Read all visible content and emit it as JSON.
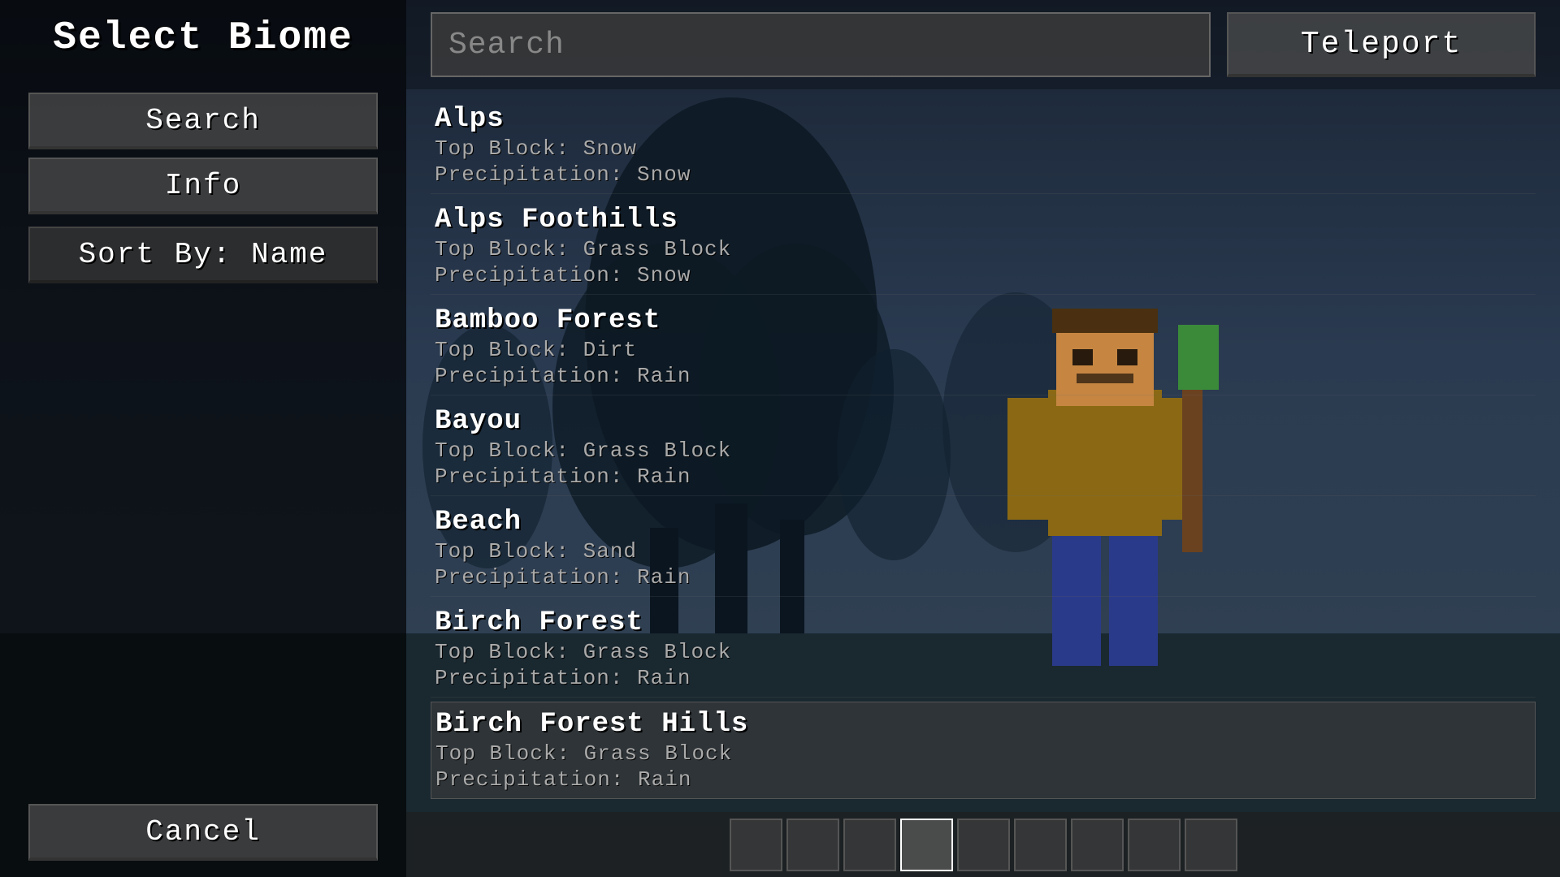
{
  "title": "Select Biome",
  "searchPlaceholder": "Search",
  "buttons": {
    "search": "Search",
    "info": "Info",
    "sort": "Sort By: Name",
    "cancel": "Cancel",
    "teleport": "Teleport"
  },
  "biomes": [
    {
      "name": "Alps",
      "topBlock": "Top Block: Snow",
      "precipitation": "Precipitation: Snow",
      "selected": false
    },
    {
      "name": "Alps Foothills",
      "topBlock": "Top Block: Grass Block",
      "precipitation": "Precipitation: Snow",
      "selected": false
    },
    {
      "name": "Bamboo Forest",
      "topBlock": "Top Block: Dirt",
      "precipitation": "Precipitation: Rain",
      "selected": false
    },
    {
      "name": "Bayou",
      "topBlock": "Top Block: Grass Block",
      "precipitation": "Precipitation: Rain",
      "selected": false
    },
    {
      "name": "Beach",
      "topBlock": "Top Block: Sand",
      "precipitation": "Precipitation: Rain",
      "selected": false
    },
    {
      "name": "Birch Forest",
      "topBlock": "Top Block: Grass Block",
      "precipitation": "Precipitation: Rain",
      "selected": false
    },
    {
      "name": "Birch Forest Hills",
      "topBlock": "Top Block: Grass Block",
      "precipitation": "Precipitation: Rain",
      "selected": true
    }
  ],
  "colors": {
    "background": "#2a3a4a",
    "panelBg": "rgba(0,0,0,0.45)",
    "buttonBg": "rgba(80,80,80,0.7)",
    "accent": "#ffffff",
    "textMuted": "#aaaaaa"
  }
}
